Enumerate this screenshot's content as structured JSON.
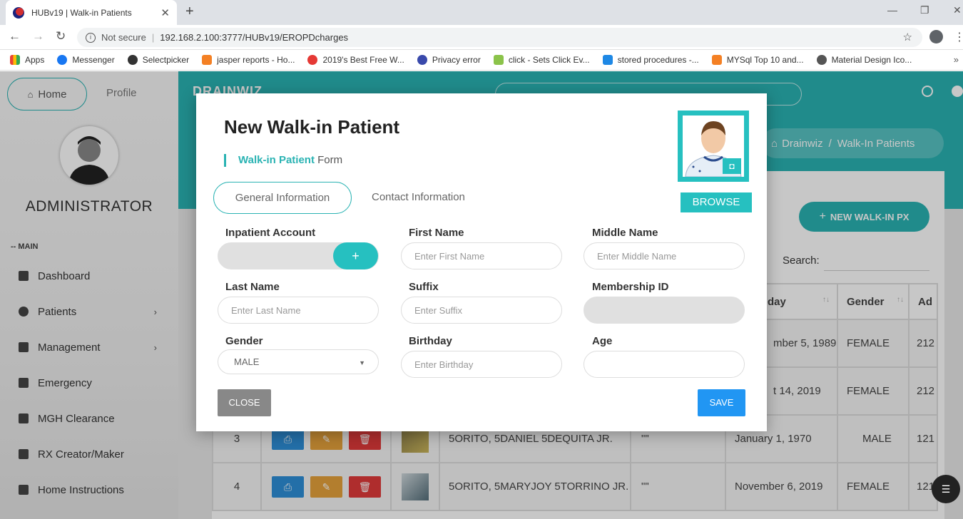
{
  "browser": {
    "tab_title": "HUBv19 | Walk-in Patients",
    "not_secure": "Not secure",
    "url": "192.168.2.100:3777/HUBv19/EROPDcharges",
    "bookmarks": [
      "Apps",
      "Messenger",
      "Selectpicker",
      "jasper reports - Ho...",
      "2019's Best Free W...",
      "Privacy error",
      "click - Sets Click Ev...",
      "stored procedures -...",
      "MYSql Top 10 and...",
      "Material Design Ico..."
    ]
  },
  "sidebar": {
    "home_label": "Home",
    "profile_label": "Profile",
    "role": "ADMINISTRATOR",
    "section": "-- MAIN",
    "items": [
      {
        "label": "Dashboard"
      },
      {
        "label": "Patients"
      },
      {
        "label": "Management"
      },
      {
        "label": "Emergency"
      },
      {
        "label": "MGH Clearance"
      },
      {
        "label": "RX Creator/Maker"
      },
      {
        "label": "Home Instructions"
      }
    ]
  },
  "topnav": {
    "brand": "DRAINWIZ"
  },
  "main": {
    "breadcrumb_root": "Drainwiz",
    "breadcrumb_sep": "/",
    "breadcrumb_current": "Walk-In Patients",
    "new_px_button": "NEW WALK-IN PX",
    "search_label": "Search:",
    "table": {
      "headers": [
        "day",
        "Gender",
        "Ad"
      ],
      "rows": [
        {
          "num": "",
          "name": "",
          "suffix": "",
          "birthday": "mber 5, 1989",
          "gender": "FEMALE",
          "addr": "212"
        },
        {
          "num": "",
          "name": "",
          "suffix": "",
          "birthday": "t 14, 2019",
          "gender": "FEMALE",
          "addr": "212"
        },
        {
          "num": "3",
          "name": "5ORITO, 5DANIEL 5DEQUITA JR.",
          "suffix": "\"\"",
          "birthday": "January 1, 1970",
          "gender": "MALE",
          "addr": "121"
        },
        {
          "num": "4",
          "name": "5ORITO, 5MARYJOY 5TORRINO JR.",
          "suffix": "\"\"",
          "birthday": "November 6, 2019",
          "gender": "FEMALE",
          "addr": "121"
        }
      ]
    }
  },
  "modal": {
    "title": "New Walk-in Patient",
    "subtitle_accent": "Walk-in Patient",
    "subtitle_rest": " Form",
    "browse_label": "BROWSE",
    "tabs": {
      "general": "General Information",
      "contact": "Contact Information"
    },
    "fields": {
      "inpatient_account": {
        "label": "Inpatient Account",
        "plus": "+"
      },
      "first_name": {
        "label": "First Name",
        "placeholder": "Enter First Name"
      },
      "middle_name": {
        "label": "Middle Name",
        "placeholder": "Enter Middle Name"
      },
      "last_name": {
        "label": "Last Name",
        "placeholder": "Enter Last Name"
      },
      "suffix": {
        "label": "Suffix",
        "placeholder": "Enter Suffix"
      },
      "membership_id": {
        "label": "Membership ID"
      },
      "gender": {
        "label": "Gender",
        "value": "MALE"
      },
      "birthday": {
        "label": "Birthday",
        "placeholder": "Enter Birthday"
      },
      "age": {
        "label": "Age"
      }
    },
    "close_label": "CLOSE",
    "save_label": "SAVE"
  },
  "colors": {
    "teal": "#2ab3b3",
    "save_blue": "#2196f3",
    "close_grey": "#888888"
  }
}
